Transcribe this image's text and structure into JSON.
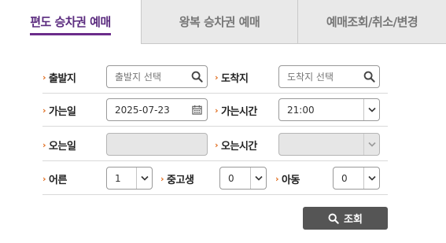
{
  "tabs": [
    {
      "label": "편도 승차권 예매",
      "active": true
    },
    {
      "label": "왕복 승차권 예매",
      "active": false
    },
    {
      "label": "예매조회/취소/변경",
      "active": false
    }
  ],
  "form": {
    "arrow": "›",
    "departure": {
      "label": "출발지",
      "placeholder": "출발지 선택"
    },
    "arrival": {
      "label": "도착지",
      "placeholder": "도착지 선택"
    },
    "go_date": {
      "label": "가는일",
      "value": "2025-07-23"
    },
    "go_time": {
      "label": "가는시간",
      "value": "21:00"
    },
    "return_date": {
      "label": "오는일",
      "value": ""
    },
    "return_time": {
      "label": "오는시간",
      "value": ""
    },
    "adult": {
      "label": "어른",
      "value": "1"
    },
    "youth": {
      "label": "중고생",
      "value": "0"
    },
    "child": {
      "label": "아동",
      "value": "0"
    }
  },
  "search_button": {
    "label": "조회"
  },
  "colors": {
    "accent": "#6b2c8a",
    "arrow": "#e06a1a",
    "button": "#555555",
    "inactive_tab": "#e9e9e9"
  }
}
